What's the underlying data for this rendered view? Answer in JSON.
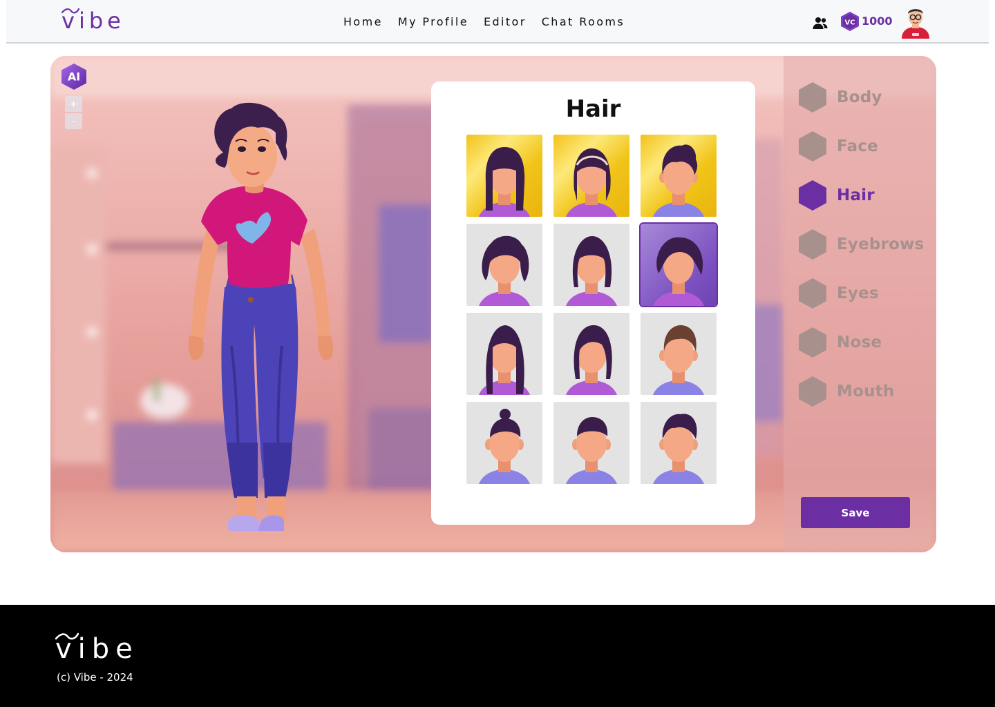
{
  "brand": {
    "name": "vibe",
    "accent": "#6b2fa3"
  },
  "nav": {
    "links": [
      "Home",
      "My Profile",
      "Editor",
      "Chat Rooms"
    ],
    "coin_badge": "VC",
    "coin_balance": "1000"
  },
  "editor": {
    "ai_badge": "AI",
    "zoom_in": "+",
    "zoom_out": "-",
    "panel_title": "Hair",
    "hair_options": [
      {
        "style": "long-bangs",
        "background": "yellow",
        "selected": false
      },
      {
        "style": "headband-bob",
        "background": "yellow",
        "selected": false
      },
      {
        "style": "short-male",
        "background": "yellow",
        "selected": false
      },
      {
        "style": "curly-bob",
        "background": "gray",
        "selected": false
      },
      {
        "style": "straight-bob",
        "background": "gray",
        "selected": false
      },
      {
        "style": "wavy-short",
        "background": "purple",
        "selected": true
      },
      {
        "style": "long-straight",
        "background": "gray",
        "selected": false
      },
      {
        "style": "side-part-bob",
        "background": "gray",
        "selected": false
      },
      {
        "style": "short-brown",
        "background": "gray",
        "selected": false
      },
      {
        "style": "man-bun",
        "background": "gray",
        "selected": false
      },
      {
        "style": "buzz-fade",
        "background": "gray",
        "selected": false
      },
      {
        "style": "textured-crop",
        "background": "gray",
        "selected": false
      }
    ],
    "categories": [
      {
        "label": "Body",
        "active": false
      },
      {
        "label": "Face",
        "active": false
      },
      {
        "label": "Hair",
        "active": true
      },
      {
        "label": "Eyebrows",
        "active": false
      },
      {
        "label": "Eyes",
        "active": false
      },
      {
        "label": "Nose",
        "active": false
      },
      {
        "label": "Mouth",
        "active": false
      }
    ],
    "save_label": "Save"
  },
  "footer": {
    "brand": "vibe",
    "copyright": "(c) Vibe - 2024"
  }
}
